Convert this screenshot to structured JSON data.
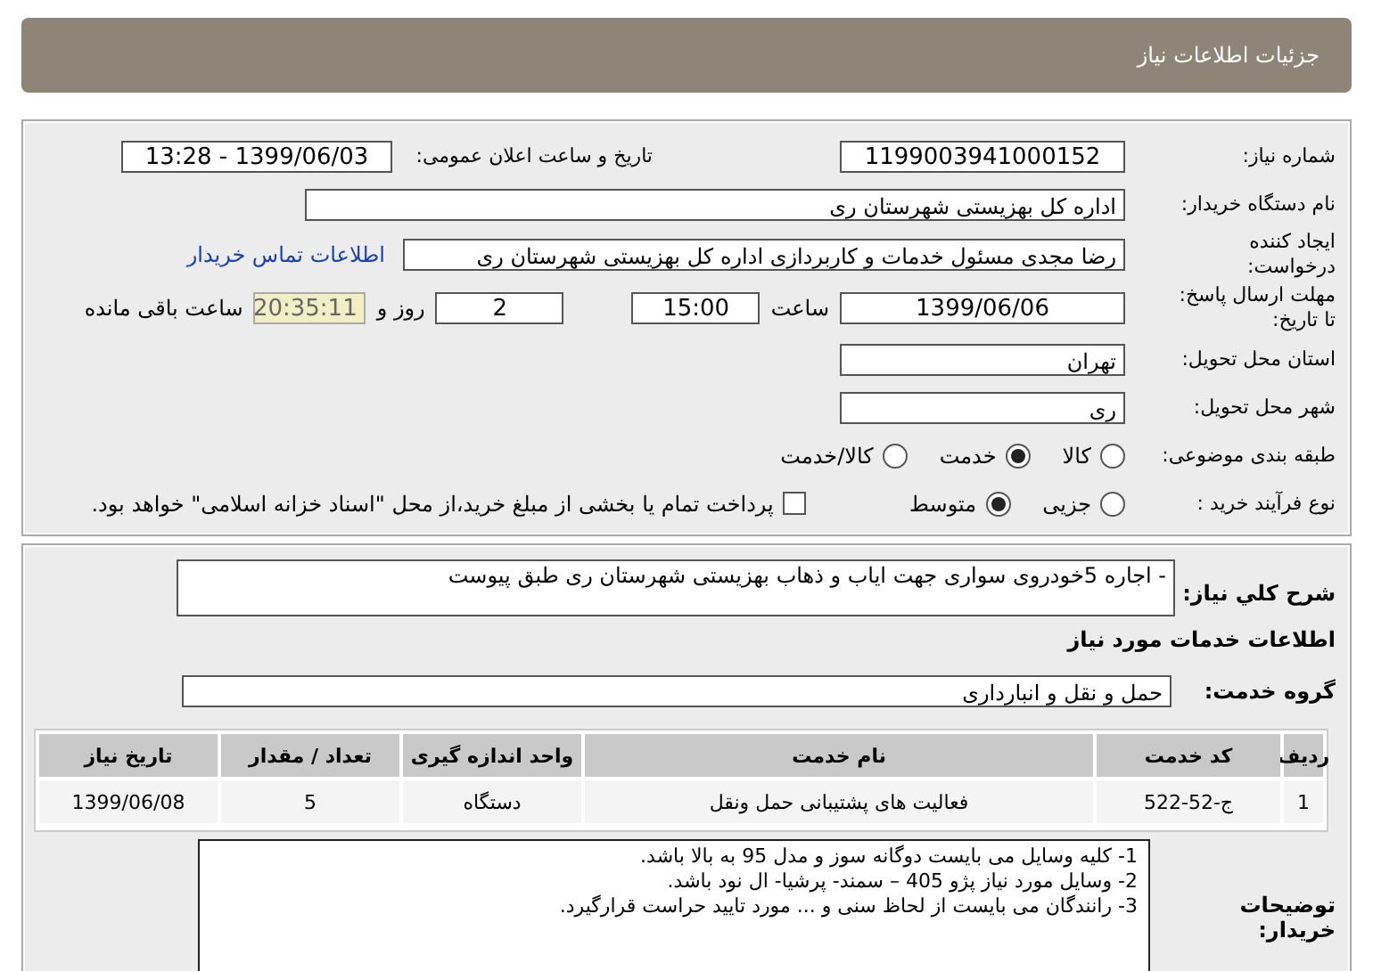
{
  "header": {
    "title": "جزئیات اطلاعات نیاز"
  },
  "need_number": {
    "label": "شماره نیاز:",
    "value": "1199003941000152"
  },
  "announce": {
    "label": "تاریخ و ساعت اعلان عمومی:",
    "value": "1399/06/03 - 13:28"
  },
  "buyer": {
    "label": "نام دستگاه خریدار:",
    "value": "اداره کل بهزیستی شهرستان ری"
  },
  "creator": {
    "label": "ایجاد کننده",
    "label_2": "درخواست:",
    "value": "رضا مجدی مسئول خدمات و کاربردازی اداره کل بهزیستی شهرستان ری",
    "link": "اطلاعات تماس خریدار"
  },
  "deadline": {
    "label": "مهلت ارسال پاسخ:",
    "label_2": "تا تاریخ:",
    "date": "1399/06/06",
    "time_label": "ساعت",
    "time": "15:00",
    "days": "2",
    "days_label": "روز و",
    "remaining": "20:35:11",
    "remaining_label": "ساعت باقی مانده"
  },
  "province": {
    "label": "استان محل تحویل:",
    "value": "تهران"
  },
  "city": {
    "label": "شهر محل تحویل:",
    "value": "ری"
  },
  "category": {
    "label": "طبقه بندی موضوعی:",
    "options": [
      {
        "label": "کالا",
        "selected": false
      },
      {
        "label": "خدمت",
        "selected": true
      },
      {
        "label": "کالا/خدمت",
        "selected": false
      }
    ]
  },
  "process": {
    "label": "نوع فرآیند خرید :",
    "options": [
      {
        "label": "جزیی",
        "selected": false
      },
      {
        "label": "متوسط",
        "selected": true
      }
    ],
    "payment": {
      "label": "پرداخت تمام یا بخشی از مبلغ خرید،از محل \"اسناد خزانه اسلامی\" خواهد بود.",
      "checked": false
    }
  },
  "summary": {
    "label": "شرح کلي نياز:",
    "value": "- اجاره 5خودروی سواری جهت ایاب و ذهاب بهزیستی شهرستان ری طبق پیوست"
  },
  "services_title": "اطلاعات خدمات مورد نیاز",
  "service_group": {
    "label": "گروه خدمت:",
    "value": "حمل و نقل و انبارداری"
  },
  "table": {
    "columns": [
      "ردیف",
      "کد خدمت",
      "نام خدمت",
      "واحد اندازه گیری",
      "تعداد / مقدار",
      "تاریخ نیاز"
    ],
    "rows": [
      [
        "1",
        "ج-52-522",
        "فعالیت های پشتیبانی حمل ونقل",
        "دستگاه",
        "5",
        "1399/06/08"
      ]
    ]
  },
  "notes": {
    "label": "توضیحات خریدار:",
    "lines": [
      "1- کلیه وسایل می بایست دوگانه سوز و مدل 95 به بالا باشد.",
      "2- وسایل مورد نیاز پژو 405 – سمند- پرشیا- ال نود باشد.",
      "3- رانندگان می بایست از لحاظ سنی و ... مورد تایید حراست قرارگیرد."
    ]
  }
}
